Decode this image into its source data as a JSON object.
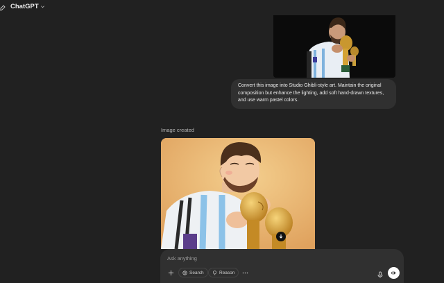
{
  "app": {
    "title": "ChatGPT"
  },
  "conversation": {
    "user_message": "Convert this image into Studio Ghibli-style art. Maintain the original composition but enhance the lighting, add soft hand-drawn textures, and use warm pastel colors.",
    "assistant_status": "Image created"
  },
  "composer": {
    "placeholder": "Ask anything",
    "search_label": "Search",
    "reason_label": "Reason"
  },
  "icons": {
    "edit": "new-chat-icon",
    "chevron": "chevron-down-icon",
    "download": "download-icon",
    "plus": "plus-icon",
    "globe": "globe-icon",
    "bulb": "lightbulb-icon",
    "more": "more-icon",
    "mic": "mic-icon",
    "voice": "voice-mode-icon"
  },
  "colors": {
    "background": "#212121",
    "bubble": "#303030",
    "text": "#ececec",
    "muted": "#b4b4b4"
  }
}
